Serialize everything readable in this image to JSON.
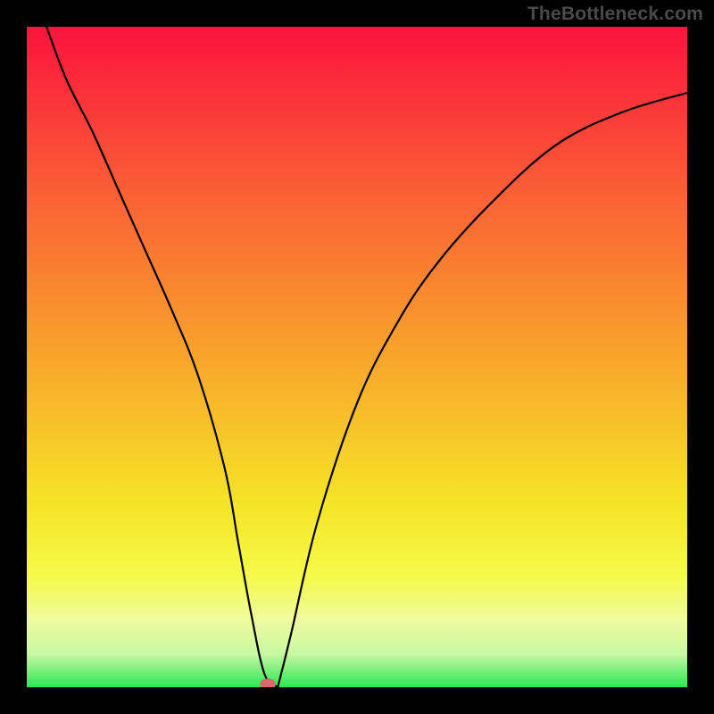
{
  "watermark": "TheBottleneck.com",
  "chart_data": {
    "type": "line",
    "title": "",
    "xlabel": "",
    "ylabel": "",
    "xlim": [
      0,
      100
    ],
    "ylim": [
      0,
      100
    ],
    "grid": false,
    "legend": false,
    "series": [
      {
        "name": "curve",
        "x": [
          3,
          6,
          10,
          14,
          18,
          22,
          26,
          30,
          32,
          34,
          36,
          38,
          40,
          44,
          50,
          56,
          62,
          70,
          80,
          90,
          100
        ],
        "values": [
          100,
          92,
          84,
          75,
          66,
          57,
          47,
          33,
          22,
          11,
          2,
          0,
          8,
          25,
          43,
          55,
          64,
          73,
          82,
          87,
          90
        ]
      }
    ],
    "marker": {
      "x": 36.5,
      "y": 0.5
    },
    "gradient_stops": [
      {
        "offset": 0,
        "color": "#fb133e"
      },
      {
        "offset": 24,
        "color": "#fa5c35"
      },
      {
        "offset": 50,
        "color": "#f8a52b"
      },
      {
        "offset": 72,
        "color": "#f5e426"
      },
      {
        "offset": 83,
        "color": "#f5fa47"
      },
      {
        "offset": 90,
        "color": "#eefba0"
      },
      {
        "offset": 95,
        "color": "#c7f8a2"
      },
      {
        "offset": 100,
        "color": "#2ae854"
      }
    ]
  }
}
